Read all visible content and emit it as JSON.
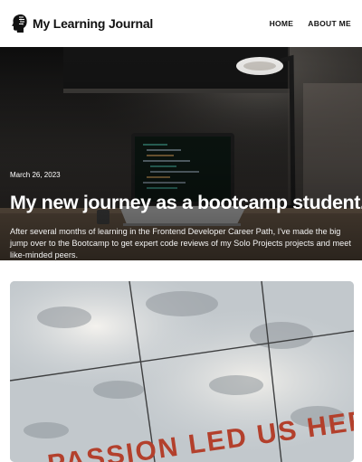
{
  "header": {
    "logo_icon": "head-profile-icon",
    "title": "My Learning Journal",
    "nav": [
      {
        "label": "HOME"
      },
      {
        "label": "ABOUT ME"
      }
    ]
  },
  "hero": {
    "date": "March 26, 2023",
    "title": "My new journey as a bootcamp student.",
    "excerpt": "After several months of learning in the Frontend Developer Career Path, I've made the big jump over to the Bootcamp to get expert code reviews of my Solo Projects projects and meet like-minded peers."
  },
  "card": {
    "image_text": "PASSION LED US HERE"
  },
  "colors": {
    "text_dark": "#111111",
    "hero_text": "#ffffff"
  }
}
